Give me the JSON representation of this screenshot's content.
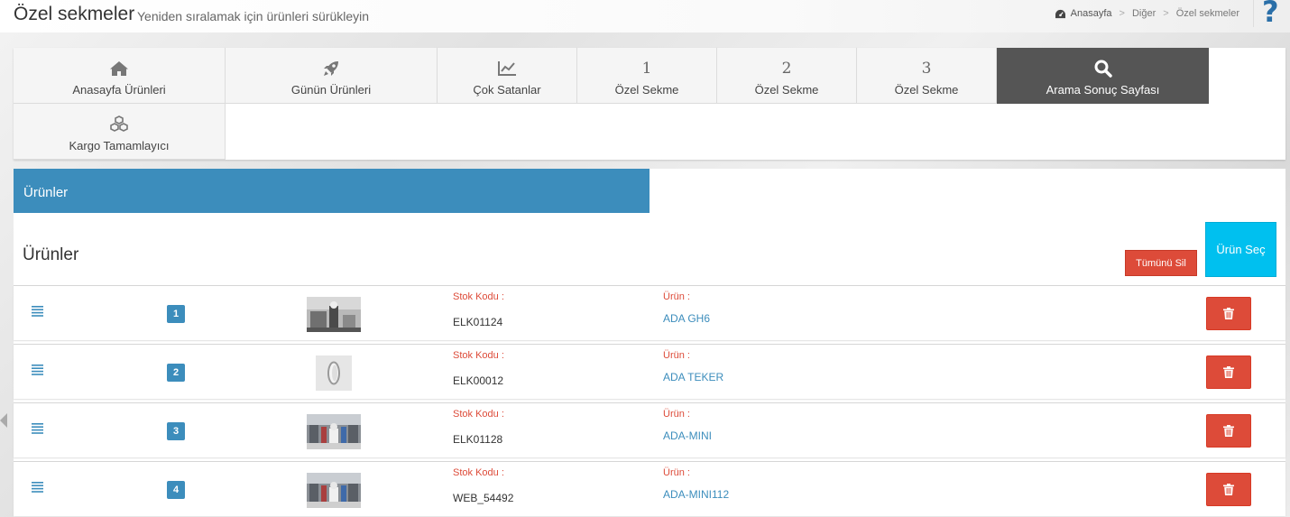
{
  "header": {
    "title": "Özel sekmeler",
    "subtitle": "Yeniden sıralamak için ürünleri sürükleyin",
    "breadcrumb": [
      "Anasayfa",
      "Diğer",
      "Özel sekmeler"
    ],
    "help": "?"
  },
  "tabs": [
    {
      "label": "Anasayfa Ürünleri",
      "icon": "home-icon",
      "active": false
    },
    {
      "label": "Günün Ürünleri",
      "icon": "rocket-icon",
      "active": false
    },
    {
      "label": "Çok Satanlar",
      "icon": "line-chart-icon",
      "active": false
    },
    {
      "label": "Özel Sekme",
      "number": "1",
      "active": false
    },
    {
      "label": "Özel Sekme",
      "number": "2",
      "active": false
    },
    {
      "label": "Özel Sekme",
      "number": "3",
      "active": false
    },
    {
      "label": "Arama Sonuç Sayfası",
      "icon": "search-icon",
      "active": true
    },
    {
      "label": "Kargo Tamamlayıcı",
      "icon": "cubes-icon",
      "active": false
    }
  ],
  "products_panel": {
    "header_title": "Ürünler",
    "section_title": "Ürünler",
    "delete_all_label": "Tümünü Sil",
    "select_product_label": "Ürün Seç",
    "stock_code_label": "Stok Kodu :",
    "product_label": "Ürün :",
    "rows": [
      {
        "order": "1",
        "stock_code": "ELK01124",
        "product_name": "ADA GH6",
        "thumbnail": "robot-photo"
      },
      {
        "order": "2",
        "stock_code": "ELK00012",
        "product_name": "ADA TEKER",
        "thumbnail": "wheel-photo"
      },
      {
        "order": "3",
        "stock_code": "ELK01128",
        "product_name": "ADA-MINI",
        "thumbnail": "robot-mall-photo"
      },
      {
        "order": "4",
        "stock_code": "WEB_54492",
        "product_name": "ADA-MINI112",
        "thumbnail": "robot-mall-photo"
      }
    ]
  },
  "colors": {
    "primary": "#3c8dbc",
    "danger": "#dd4b39",
    "info": "#00c0ef",
    "active_tab": "#555555"
  }
}
